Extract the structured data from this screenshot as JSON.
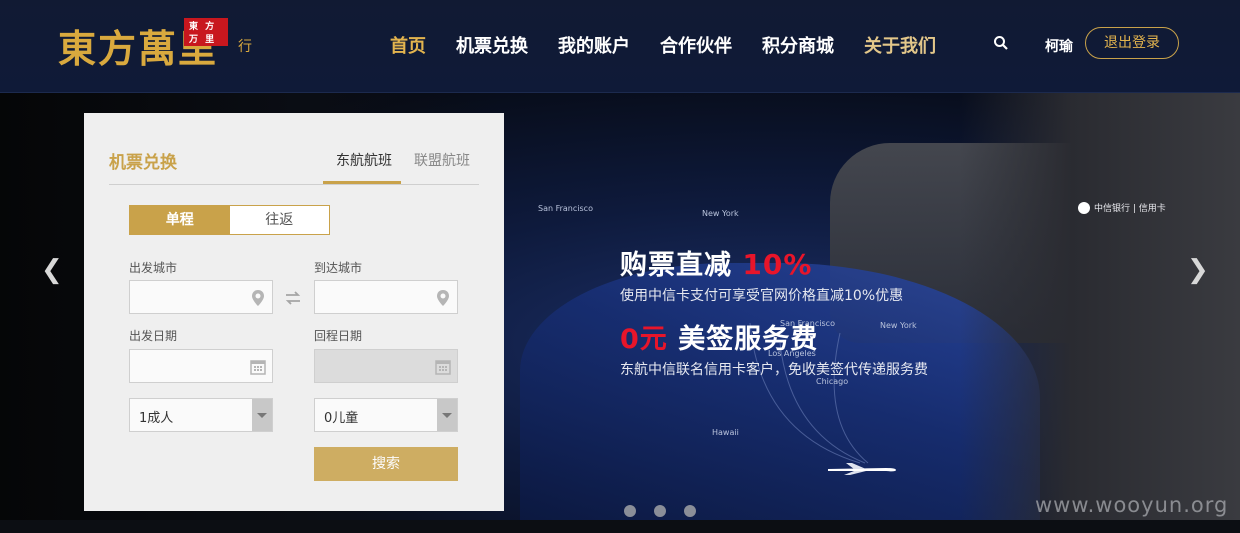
{
  "header": {
    "logo_text": "東方萬里",
    "logo_badge": "東 方 万 里",
    "logo_sig": "行",
    "nav": [
      {
        "label": "首页",
        "state": "active"
      },
      {
        "label": "机票兑换",
        "state": "normal"
      },
      {
        "label": "我的账户",
        "state": "normal"
      },
      {
        "label": "合作伙伴",
        "state": "normal"
      },
      {
        "label": "积分商城",
        "state": "normal"
      },
      {
        "label": "关于我们",
        "state": "gold"
      }
    ],
    "search_icon": "search-icon",
    "username": "柯瑜",
    "logout_label": "退出登录"
  },
  "banner": {
    "line1_prefix": "购票直减 ",
    "line1_highlight": "10%",
    "line2": "使用中信卡支付可享受官网价格直减10%优惠",
    "line3_highlight": "0元",
    "line3_suffix": " 美签服务费",
    "line4": "东航中信联名信用卡客户，免收美签代传递服务费",
    "cities": [
      "San Francisco",
      "New York",
      "San Francisco",
      "Los Angeles",
      "New York",
      "Chicago",
      "Hawaii"
    ],
    "bank_name": "中信银行 | 信用卡",
    "prev_arrow": "❮",
    "next_arrow": "❯",
    "slide_count": 3,
    "watermark": "www.wooyun.org"
  },
  "booking": {
    "title": "机票兑换",
    "tabs": [
      "东航航班",
      "联盟航班"
    ],
    "active_tab": 0,
    "trip_types": [
      "单程",
      "往返"
    ],
    "active_trip": 0,
    "depart_city_label": "出发城市",
    "arrive_city_label": "到达城市",
    "depart_date_label": "出发日期",
    "return_date_label": "回程日期",
    "adults": "1成人",
    "children": "0儿童",
    "search_label": "搜索"
  },
  "colors": {
    "gold": "#c9a24a",
    "header_bg": "#111a33",
    "promo_red": "#e8152a"
  }
}
